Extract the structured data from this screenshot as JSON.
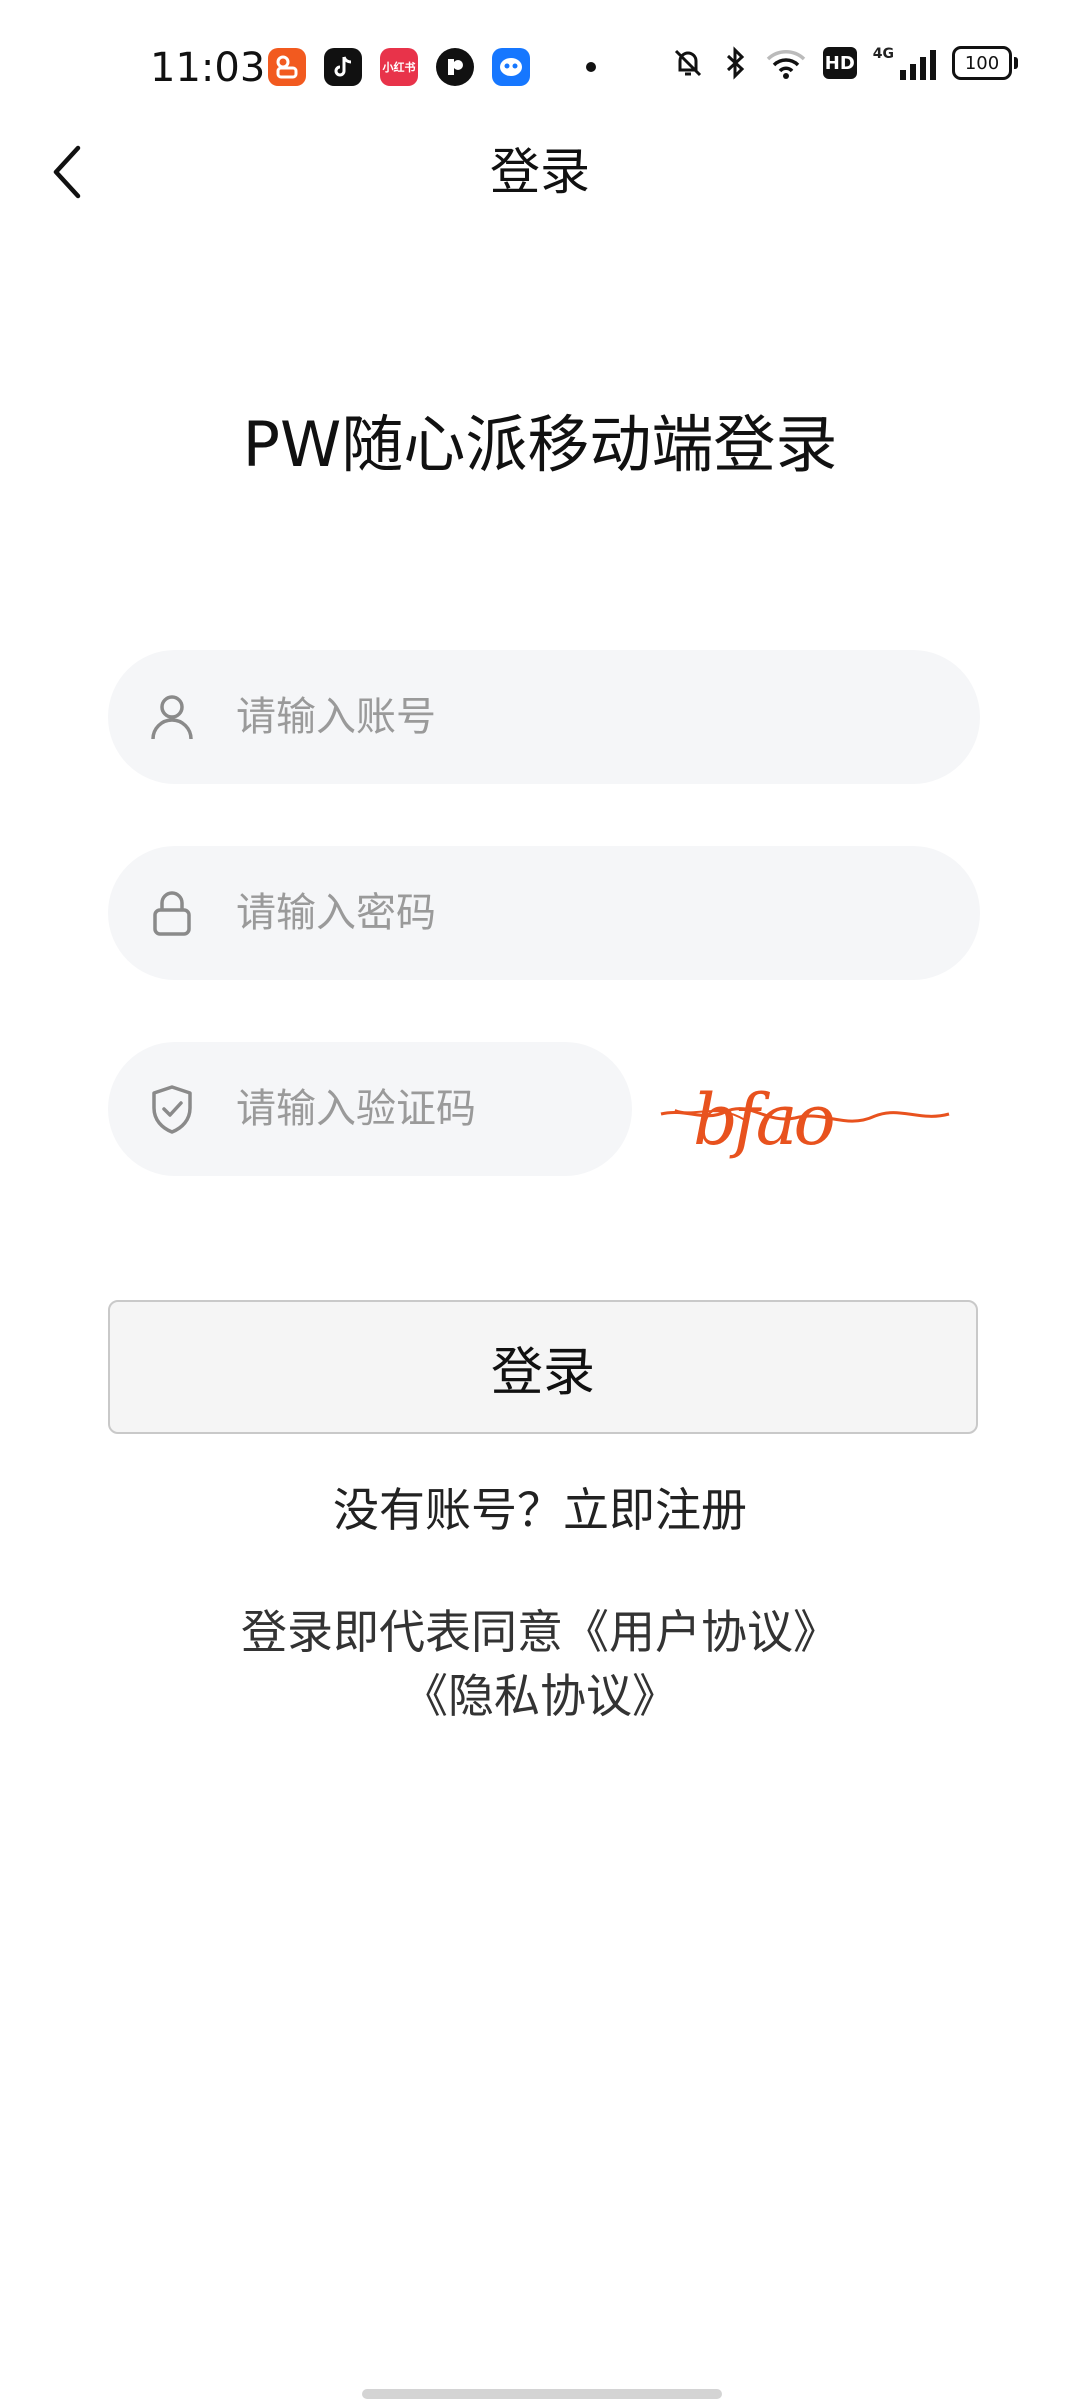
{
  "status_bar": {
    "time": "11:03",
    "app_icons": [
      {
        "name": "kuaishou-icon",
        "color": "#F25A1F",
        "glyph": "⦿"
      },
      {
        "name": "tiktok-icon",
        "color": "#111111",
        "glyph": "♪"
      },
      {
        "name": "xiaohongshu-icon",
        "color": "#E8334A",
        "glyph": "小红书"
      },
      {
        "name": "app-p-icon",
        "color": "#111111",
        "glyph": "P"
      },
      {
        "name": "robot-app-icon",
        "color": "#1677FF",
        "glyph": "☺"
      }
    ],
    "battery": "100",
    "hd": "HD",
    "network": "4G"
  },
  "nav": {
    "title": "登录"
  },
  "heading": "PW随心派移动端登录",
  "form": {
    "account_placeholder": "请输入账号",
    "password_placeholder": "请输入密码",
    "captcha_placeholder": "请输入验证码",
    "captcha_text": "bfao",
    "captcha_color": "#E8521E",
    "login_label": "登录"
  },
  "register": {
    "prompt": "没有账号？",
    "link": "立即注册"
  },
  "agreement": {
    "prefix": "登录即代表同意",
    "user_agreement": "《用户协议》",
    "privacy_agreement": "《隐私协议》"
  }
}
